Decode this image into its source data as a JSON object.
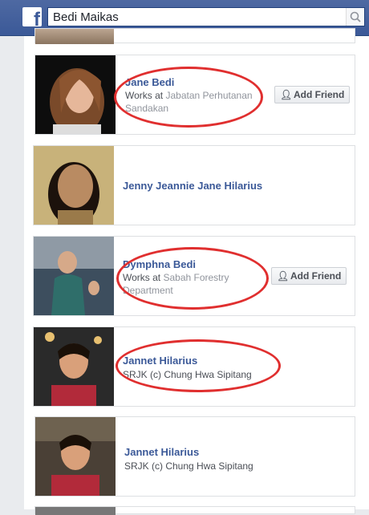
{
  "search": {
    "value": "Bedi Maikas"
  },
  "add_friend_label": "Add Friend",
  "results": [
    {
      "name": "Jane Bedi",
      "works_prefix": "Works at",
      "works_place": "Jabatan Perhutanan",
      "works_place2": "Sandakan"
    },
    {
      "name": "Jenny Jeannie Jane Hilarius"
    },
    {
      "name": "Dymphna Bedi",
      "works_prefix": "Works at",
      "works_place": "Sabah Forestry",
      "works_place2": "Department"
    },
    {
      "name": "Jannet Hilarius",
      "detail": "SRJK (c) Chung Hwa Sipitang"
    },
    {
      "name": "Jannet Hilarius",
      "detail": "SRJK (c) Chung Hwa Sipitang"
    }
  ],
  "colors": {
    "brand": "#3b5998",
    "annotation": "#e02f2f"
  }
}
